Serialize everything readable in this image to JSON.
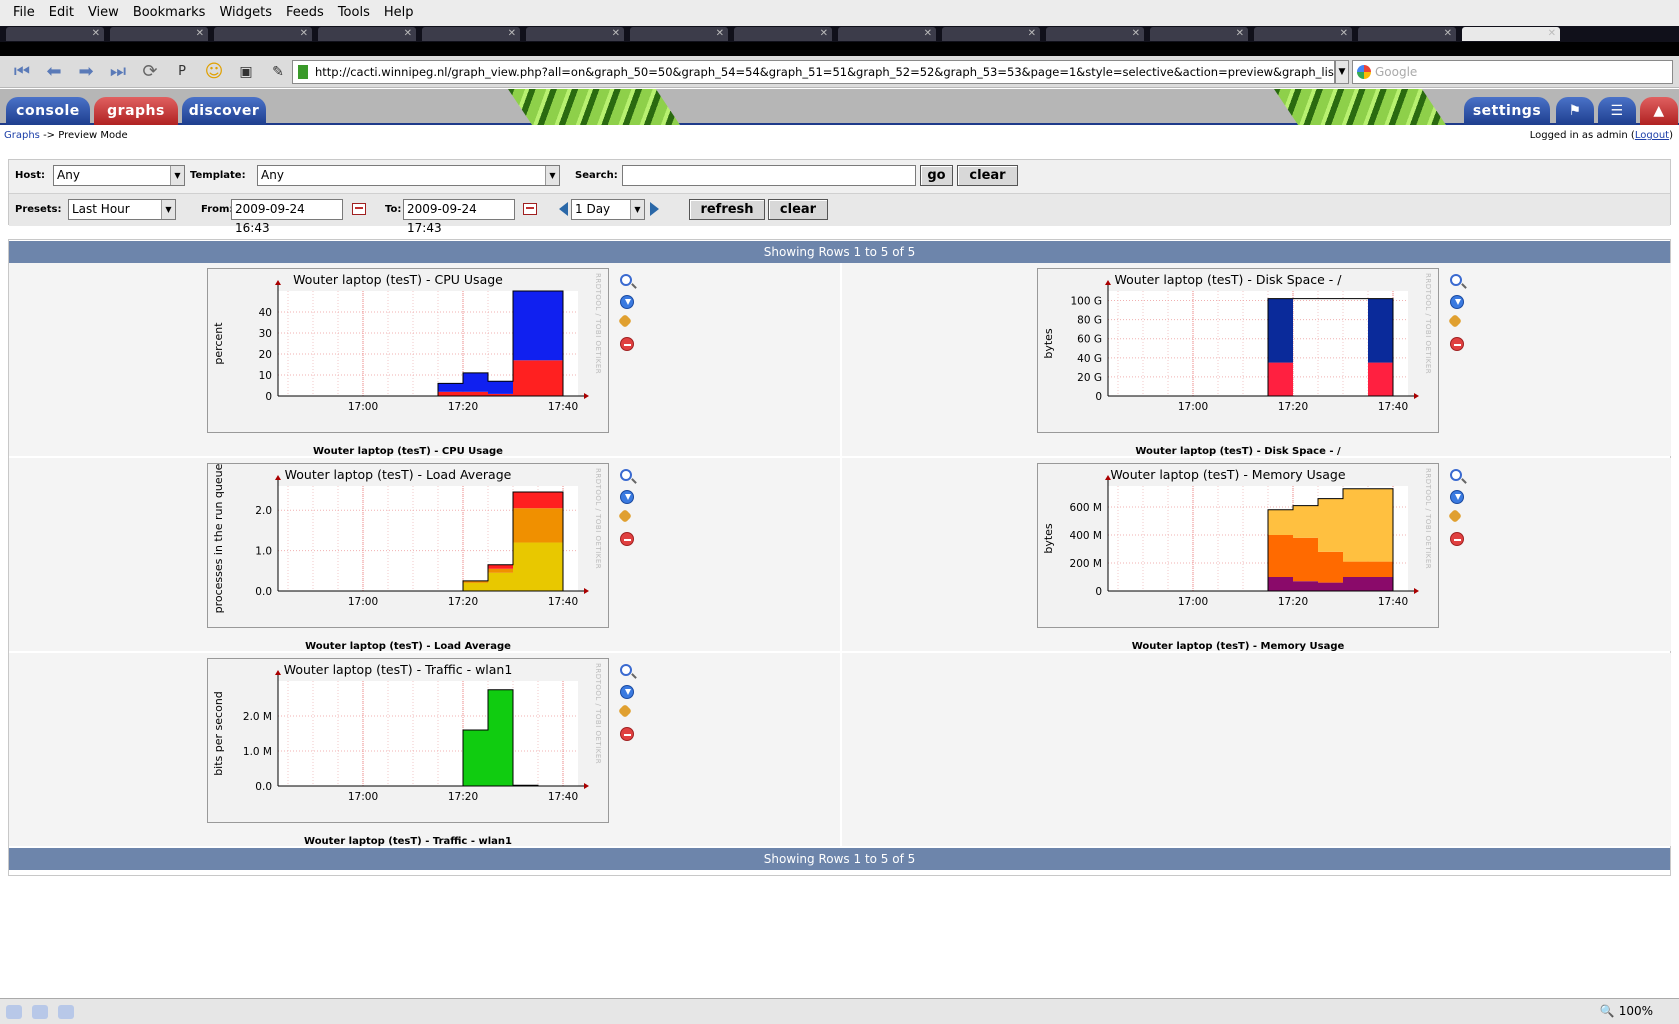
{
  "browser": {
    "menu": [
      "File",
      "Edit",
      "View",
      "Bookmarks",
      "Widgets",
      "Feeds",
      "Tools",
      "Help"
    ],
    "url": "http://cacti.winnipeg.nl/graph_view.php?all=on&graph_50=50&graph_54=54&graph_51=51&graph_52=52&graph_53=53&page=1&style=selective&action=preview&graph_list=&grap",
    "search_placeholder": "Google",
    "zoom": "100%"
  },
  "cacti": {
    "tabs": {
      "console": "console",
      "graphs": "graphs",
      "discover": "discover",
      "settings": "settings"
    },
    "breadcrumb": {
      "link": "Graphs",
      "rest": "-> Preview Mode"
    },
    "login": {
      "prefix": "Logged in as admin (",
      "link": "Logout",
      "suffix": ")"
    }
  },
  "filter": {
    "host_label": "Host:",
    "host_value": "Any",
    "template_label": "Template:",
    "template_value": "Any",
    "search_label": "Search:",
    "search_value": "",
    "go": "go",
    "clear": "clear",
    "presets_label": "Presets:",
    "presets_value": "Last Hour",
    "from_label": "From:",
    "from_value": "2009-09-24 16:43",
    "to_label": "To:",
    "to_value": "2009-09-24 17:43",
    "span_value": "1 Day",
    "refresh": "refresh",
    "clear2": "clear"
  },
  "showing": "Showing Rows 1 to 5 of 5",
  "rrd_watermark": "RRDTOOL / TOBI OETIKER",
  "graphs": [
    {
      "title": "Wouter laptop (tesT) - CPU Usage",
      "caption": "Wouter laptop (tesT) - CPU Usage"
    },
    {
      "title": "Wouter laptop (tesT) - Disk Space - /",
      "caption": "Wouter laptop (tesT) - Disk Space - /"
    },
    {
      "title": "Wouter laptop (tesT) - Load Average",
      "caption": "Wouter laptop (tesT) - Load Average"
    },
    {
      "title": "Wouter laptop (tesT) - Memory Usage",
      "caption": "Wouter laptop (tesT) - Memory Usage"
    },
    {
      "title": "Wouter laptop (tesT) - Traffic - wlan1",
      "caption": "Wouter laptop (tesT) - Traffic - wlan1"
    }
  ],
  "chart_data": [
    {
      "type": "area",
      "title": "Wouter laptop (tesT) - CPU Usage",
      "ylabel": "percent",
      "xticks": [
        "17:00",
        "17:20",
        "17:40"
      ],
      "yticks": [
        "0",
        "10",
        "20",
        "30",
        "40"
      ],
      "ylim": [
        0,
        50
      ],
      "x": [
        "17:20",
        "17:25",
        "17:30",
        "17:35",
        "17:40"
      ],
      "series": [
        {
          "color": "#ff2020",
          "values": [
            2,
            2,
            1,
            17,
            17
          ]
        },
        {
          "color": "#1020f0",
          "values": [
            4,
            9,
            6,
            33,
            33
          ]
        }
      ]
    },
    {
      "type": "area",
      "title": "Wouter laptop (tesT) - Disk Space - /",
      "ylabel": "bytes",
      "xticks": [
        "17:00",
        "17:20",
        "17:40"
      ],
      "yticks": [
        "0",
        "20 G",
        "40 G",
        "60 G",
        "80 G",
        "100 G"
      ],
      "ylim": [
        0,
        110
      ],
      "x": [
        "17:20",
        "17:40"
      ],
      "series": [
        {
          "color": "#ff2040",
          "values": [
            35,
            35
          ]
        },
        {
          "color": "#0a2a9a",
          "values": [
            67,
            67
          ]
        }
      ]
    },
    {
      "type": "area",
      "title": "Wouter laptop (tesT) - Load Average",
      "ylabel": "processes in the run queue",
      "xticks": [
        "17:00",
        "17:20",
        "17:40"
      ],
      "yticks": [
        "0.0",
        "1.0",
        "2.0"
      ],
      "ylim": [
        0,
        2.6
      ],
      "x": [
        "17:25",
        "17:30",
        "17:35",
        "17:40"
      ],
      "series": [
        {
          "color": "#e8c800",
          "values": [
            0.2,
            0.45,
            1.2,
            1.2
          ]
        },
        {
          "color": "#f09000",
          "values": [
            0.05,
            0.1,
            0.85,
            0.85
          ]
        },
        {
          "color": "#ff2020",
          "values": [
            0.0,
            0.1,
            0.4,
            0.4
          ]
        }
      ]
    },
    {
      "type": "area",
      "title": "Wouter laptop (tesT) - Memory Usage",
      "ylabel": "bytes",
      "xticks": [
        "17:00",
        "17:20",
        "17:40"
      ],
      "yticks": [
        "0",
        "200 M",
        "400 M",
        "600 M"
      ],
      "ylim": [
        0,
        750
      ],
      "x": [
        "17:20",
        "17:25",
        "17:30",
        "17:35",
        "17:40"
      ],
      "series": [
        {
          "color": "#8a0a6a",
          "values": [
            100,
            70,
            60,
            100,
            100
          ]
        },
        {
          "color": "#ff6a00",
          "values": [
            300,
            310,
            220,
            110,
            110
          ]
        },
        {
          "color": "#ffc040",
          "values": [
            180,
            230,
            380,
            520,
            520
          ]
        }
      ]
    },
    {
      "type": "area",
      "title": "Wouter laptop (tesT) - Traffic - wlan1",
      "ylabel": "bits per second",
      "xticks": [
        "17:00",
        "17:20",
        "17:40"
      ],
      "yticks": [
        "0.0",
        "1.0 M",
        "2.0 M"
      ],
      "ylim": [
        0,
        3.0
      ],
      "x": [
        "17:25",
        "17:30",
        "17:35"
      ],
      "series": [
        {
          "color": "#10cc10",
          "values": [
            1.6,
            2.75,
            0.02
          ]
        }
      ]
    }
  ]
}
